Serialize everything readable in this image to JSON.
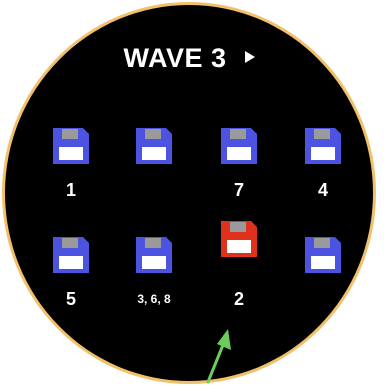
{
  "header": {
    "title": "WAVE 3",
    "play_icon": "play-icon"
  },
  "colors": {
    "bezel": "#f2c06b",
    "floppy_normal": "#4b53e0",
    "floppy_selected": "#e0301e",
    "shutter": "#9a9a9a",
    "arrow": "#6bcc5b"
  },
  "slots": [
    {
      "label": "1",
      "selected": false,
      "icon": "floppy-disk-icon"
    },
    {
      "label": "",
      "selected": false,
      "icon": "floppy-disk-icon"
    },
    {
      "label": "7",
      "selected": false,
      "icon": "floppy-disk-icon"
    },
    {
      "label": "4",
      "selected": false,
      "icon": "floppy-disk-icon"
    },
    {
      "label": "5",
      "selected": false,
      "icon": "floppy-disk-icon"
    },
    {
      "label": "3, 6, 8",
      "selected": false,
      "icon": "floppy-disk-icon"
    },
    {
      "label": "2",
      "selected": true,
      "icon": "floppy-disk-icon"
    },
    {
      "label": "",
      "selected": false,
      "icon": "floppy-disk-icon"
    }
  ],
  "pointer_icon": "arrow-up-icon"
}
